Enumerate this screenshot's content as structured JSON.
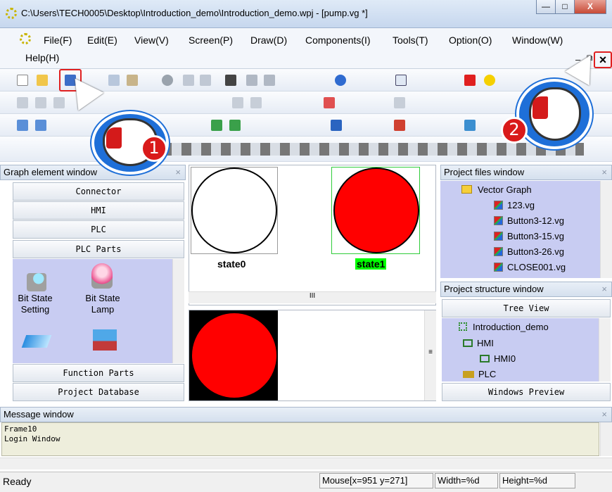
{
  "window": {
    "title": "C:\\Users\\TECH0005\\Desktop\\Introduction_demo\\Introduction_demo.wpj - [pump.vg *]",
    "min": "—",
    "max": "□",
    "close": "X"
  },
  "menu": [
    "File(F)",
    "Edit(E)",
    "View(V)",
    "Screen(P)",
    "Draw(D)",
    "Components(I)",
    "Tools(T)",
    "Option(O)",
    "Window(W)",
    "Help(H)"
  ],
  "mdi_controls": {
    "min": "–",
    "restore": "⧉",
    "close": "×"
  },
  "graph_window": {
    "title": "Graph element window",
    "close": "×",
    "categories": [
      "Connector",
      "HMI",
      "PLC",
      "PLC Parts"
    ],
    "items": [
      {
        "label1": "Bit State",
        "label2": "Setting"
      },
      {
        "label1": "Bit State",
        "label2": "Lamp"
      }
    ],
    "bottom_categories": [
      "Function Parts",
      "Project Database"
    ]
  },
  "canvas": {
    "state0": "state0",
    "state1": "state1",
    "scroll_mark": "III",
    "preview_mark": "≡"
  },
  "project_files": {
    "title": "Project files window",
    "close": "×",
    "folder": "Vector Graph",
    "files": [
      "123.vg",
      "Button3-12.vg",
      "Button3-15.vg",
      "Button3-26.vg",
      "CLOSE001.vg"
    ]
  },
  "project_structure": {
    "title": "Project structure window",
    "close": "×",
    "tree_view": "Tree View",
    "nodes": [
      "Introduction_demo",
      "HMI",
      "HMI0",
      "PLC"
    ],
    "windows_preview": "Windows Preview"
  },
  "message_window": {
    "title": "Message window",
    "close": "×",
    "lines": [
      "Frame10",
      "Login Window"
    ]
  },
  "status": {
    "ready": "Ready",
    "mouse": "Mouse[x=951  y=271]",
    "width": "Width=%d",
    "height": "Height=%d"
  },
  "callouts": [
    "1",
    "2"
  ],
  "colors": {
    "accent": "#1e6fd8",
    "badge": "#d91a1a",
    "lamp": "#ff0000",
    "highlight": "#00ff00"
  }
}
